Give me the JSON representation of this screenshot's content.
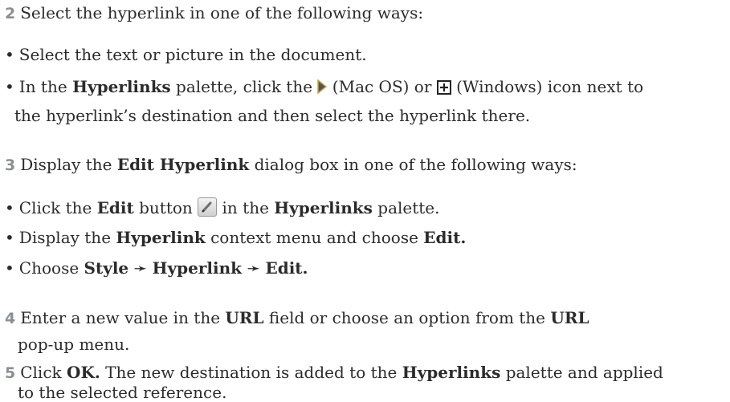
{
  "steps": [
    {
      "number": "2",
      "text": "Select the hyperlink in one of the following ways:",
      "bullets": [
        {
          "text": "Select the text or picture in the document."
        },
        {
          "pre": "In the",
          "bold1": "Hyperlinks",
          "mid": "palette, click the",
          "after_mac": "(Mac OS) or",
          "after_win": "(Windows) icon next to",
          "line2": "the hyperlink’s destination and then select the hyperlink there."
        }
      ]
    },
    {
      "number": "3",
      "pre": "Display the",
      "bold": "Edit Hyperlink",
      "post": "dialog box in one of the following ways:",
      "bullets": [
        {
          "pre": "Click the",
          "bold1": "Edit",
          "mid": "button",
          "post": "in the",
          "bold2": "Hyperlinks",
          "end": "palette."
        },
        {
          "pre": "Display the",
          "bold1": "Hyperlink",
          "mid": "context menu and choose",
          "bold2": "Edit."
        },
        {
          "pre": "Choose",
          "bold1": "Style",
          "arrow": "➛",
          "bold2": "Hyperlink",
          "bold3": "Edit."
        }
      ]
    },
    {
      "number": "4",
      "pre": "Enter a new value in the",
      "bold1": "URL",
      "mid": "field or choose an option from the",
      "bold2": "URL",
      "line2": "pop-up menu."
    },
    {
      "number": "5",
      "pre": "Click",
      "bold1": "OK.",
      "mid": "The new destination is added to the",
      "bold2": "Hyperlinks",
      "post": "palette and applied",
      "line2": "to the selected reference."
    }
  ],
  "icons": {
    "mac": "disclosure-triangle-icon",
    "windows": "plus-box-icon",
    "edit": "pencil-edit-icon"
  },
  "colors": {
    "text": "#2b2b2b",
    "step_number": "#8a8f96"
  }
}
